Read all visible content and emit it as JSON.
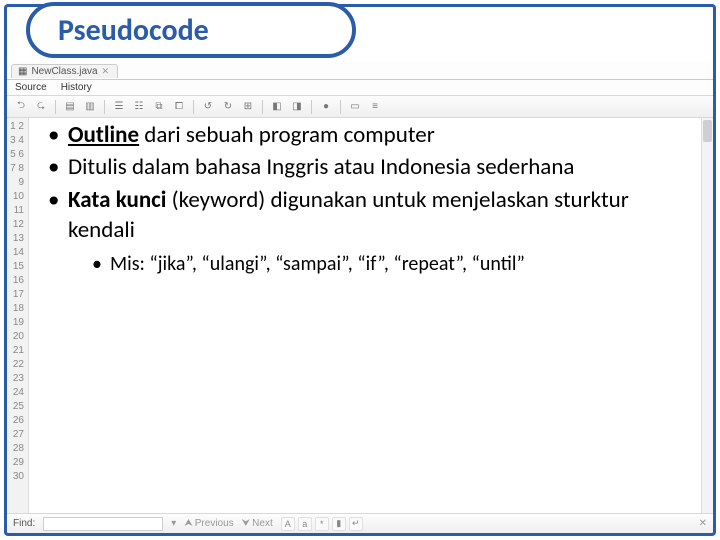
{
  "title": "Pseudocode",
  "ide": {
    "tab_label": "NewClass.java",
    "subtabs": {
      "source": "Source",
      "history": "History"
    },
    "find": {
      "label": "Find:",
      "prev": "Previous",
      "next": "Next"
    },
    "line_count": 30
  },
  "bullets": {
    "b1": {
      "strong": "Outline",
      "rest": " dari sebuah program computer"
    },
    "b2": "Ditulis dalam bahasa Inggris atau Indonesia sederhana",
    "b3": {
      "strong": "Kata kunci",
      "rest": " (keyword) digunakan untuk menjelaskan sturktur kendali"
    },
    "sub1": "Mis: “jika”, “ulangi”, “sampai”, “if”, “repeat”, “until”"
  }
}
